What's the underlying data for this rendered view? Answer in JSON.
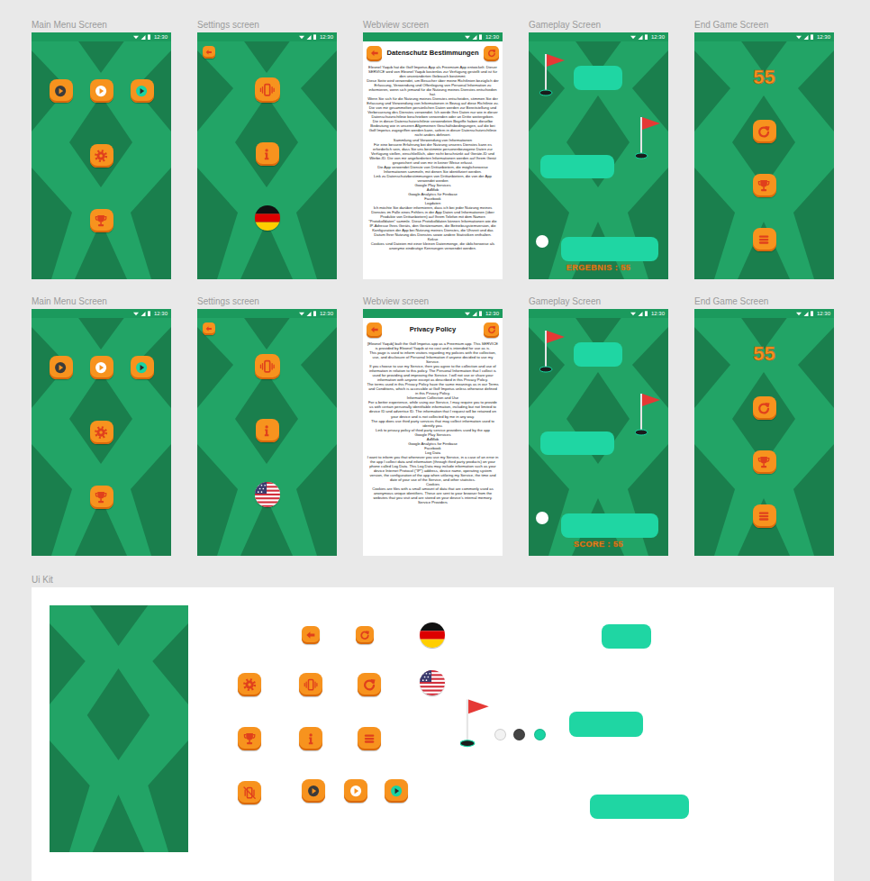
{
  "rows": [
    {
      "screens": [
        {
          "label": "Main Menu Screen",
          "kind": "main",
          "time": "12:30"
        },
        {
          "label": "Settings screen",
          "kind": "settings",
          "time": "12:30",
          "flag": "de"
        },
        {
          "label": "Webview screen",
          "kind": "webview",
          "time": "12:30",
          "title": "Datenschutz Bestimmungen",
          "body": [
            "Eleonel Yaqub hat die Golf Impetus App als Freemium App entwickelt. Dieser SERVICE wird von Eleonel Yaqub kostenlos zur Verfügung gestellt und ist für den unveränderten Gebrauch bestimmt.",
            "Diese Seite wird verwendet, um Besucher über meine Richtlinien bezüglich der Erfassung, Verwendung und Offenlegung von Personal Information zu informieren, wenn sich jemand für die Nutzung meines Dienstes entschieden hat.",
            "Wenn Sie sich für die Nutzung meines Dienstes entscheiden, stimmen Sie der Erfassung und Verwendung von Informationen in Bezug auf diese Richtlinie zu. Die von mir gesammelten persönlichen Daten werden zur Bereitstellung und Verbesserung des Dienstes verwendet. Ich werde Ihre Daten nur wie in dieser Datenschutzrichtlinie beschrieben verwenden oder an Dritte weitergeben.",
            "Die in dieser Datenschutzrichtlinie verwendeten Begriffe haben dieselbe Bedeutung wie in unseren Allgemeinen Geschäftsbedingungen, auf die bei Golf Impetus zugegriffen werden kann, sofern in dieser Datenschutzrichtlinie nicht anders definiert.",
            "Sammlung und Verwendung von Informationen",
            "Für eine bessere Erfahrung bei der Nutzung unseres Dienstes kann es erforderlich sein, dass Sie uns bestimmte personenbezogene Daten zur Verfügung stellen, einschließlich, aber nicht beschränkt auf Geräte-ID und Werbe-ID. Die von mir angeforderten Informationen werden auf Ihrem Gerät gespeichert und von mir in keiner Weise erfasst.",
            "Die App verwendet Dienste von Drittanbietern, die möglicherweise Informationen sammeln, mit denen Sie identifiziert werden.",
            "Link zu Datenschutzbestimmungen von Drittanbietern, die von der App verwendet werden",
            "Google Play Services",
            "AdMob",
            "Google Analytics für Firebase",
            "Facebook",
            "Logdaten",
            "Ich möchte Sie darüber informieren, dass ich bei jeder Nutzung meines Dienstes im Falle eines Fehlers in der App Daten und Informationen (über Produkte von Drittanbietern) auf Ihrem Telefon mit dem Namen \"Protokolldaten\" sammle. Diese Protokolldaten können Informationen wie die IP-Adresse Ihres Geräts, den Gerätenamen, die Betriebssystemversion, die Konfiguration der App bei Nutzung meines Dienstes, die Uhrzeit und das Datum Ihrer Nutzung des Dienstes sowie andere Statistiken enthalten.",
            "Kekse",
            "Cookies sind Dateien mit einer kleinen Datenmenge, die üblicherweise als anonyme eindeutige Kennungen verwendet werden."
          ]
        },
        {
          "label": "Gameplay Screen",
          "kind": "gameplay",
          "time": "12:30",
          "score": "ERGEBNIS : 55"
        },
        {
          "label": "End Game Screen",
          "kind": "endgame",
          "time": "12:30",
          "score": "55"
        }
      ]
    },
    {
      "screens": [
        {
          "label": "Main Menu Screen",
          "kind": "main",
          "time": "12:30"
        },
        {
          "label": "Settings screen",
          "kind": "settings",
          "time": "12:30",
          "flag": "us"
        },
        {
          "label": "Webview screen",
          "kind": "webview",
          "time": "12:30",
          "title": "Privacy Policy",
          "body": [
            "[Eleonel Yaqub] built the Golf Impetus app as a Freemium app. This SERVICE is provided by Eleonel Yaqub at no cost and is intended for use as is.",
            "This page is used to inform visitors regarding my policies with the collection, use, and disclosure of Personal Information if anyone decided to use my Service.",
            "If you choose to use my Service, then you agree to the collection and use of information in relation to this policy. The Personal Information that I collect is used for providing and improving the Service. I will not use or share your information with anyone except as described in this Privacy Policy.",
            "The terms used in this Privacy Policy have the same meanings as in our Terms and Conditions, which is accessible at Golf Impetus unless otherwise defined in this Privacy Policy.",
            "Information Collection and Use",
            "For a better experience, while using our Service, I may require you to provide us with certain personally identifiable information, including but not limited to device ID and advertise ID. The information that I request will be retained on your device and is not collected by me in any way.",
            "The app does use third party services that may collect information used to identify you.",
            "Link to privacy policy of third party service providers used by the app",
            "Google Play Services",
            "AdMob",
            "Google Analytics for Firebase",
            "Facebook",
            "Log Data",
            "I want to inform you that whenever you use my Service, in a case of an error in the app I collect data and information (through third party products) on your phone called Log Data. This Log Data may include information such as your device Internet Protocol (\"IP\") address, device name, operating system version, the configuration of the app when utilizing my Service, the time and date of your use of the Service, and other statistics.",
            "Cookies",
            "Cookies are files with a small amount of data that are commonly used as anonymous unique identifiers. These are sent to your browser from the websites that you visit and are stored on your device's internal memory.",
            "Service Providers"
          ]
        },
        {
          "label": "Gameplay Screen",
          "kind": "gameplay",
          "time": "12:30",
          "score": "SCORE : 55"
        },
        {
          "label": "End Game Screen",
          "kind": "endgame",
          "time": "12:30",
          "score": "55"
        }
      ]
    }
  ],
  "ui_kit": {
    "label": "Ui Kit"
  }
}
